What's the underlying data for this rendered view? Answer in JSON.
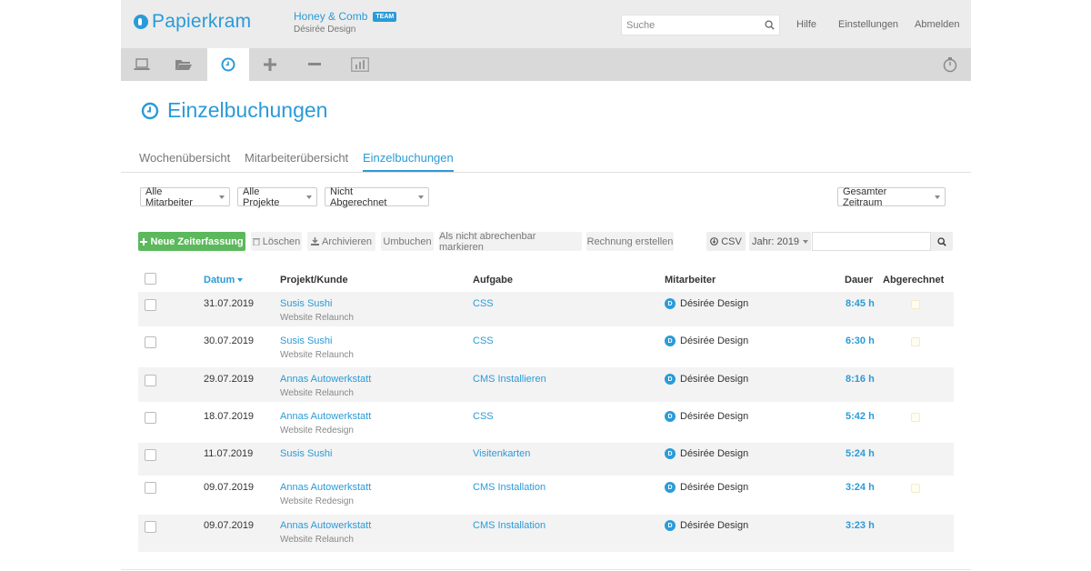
{
  "header": {
    "logo_text": "Papierkram",
    "account_name": "Honey & Comb",
    "account_badge": "TEAM",
    "account_sub": "Désirée Design",
    "search_placeholder": "Suche",
    "links": {
      "help": "Hilfe",
      "settings": "Einstellungen",
      "logout": "Abmelden"
    }
  },
  "nav": {
    "items": [
      {
        "icon": "laptop-icon"
      },
      {
        "icon": "folder-icon"
      },
      {
        "icon": "clock-icon",
        "active": true
      },
      {
        "icon": "plus-icon"
      },
      {
        "icon": "minus-icon"
      },
      {
        "icon": "bar-chart-icon"
      }
    ],
    "right_icon": "stopwatch-icon"
  },
  "page": {
    "title": "Einzelbuchungen"
  },
  "tabs": [
    {
      "label": "Wochenübersicht"
    },
    {
      "label": "Mitarbeiterübersicht"
    },
    {
      "label": "Einzelbuchungen",
      "active": true
    }
  ],
  "filters": {
    "employees": "Alle Mitarbeiter",
    "projects": "Alle Projekte",
    "billing": "Nicht Abgerechnet",
    "period": "Gesamter Zeitraum"
  },
  "toolbar": {
    "new": "Neue Zeiterfassung",
    "delete": "Löschen",
    "archive": "Archivieren",
    "rebook": "Umbuchen",
    "mark_unbillable": "Als nicht abrechenbar markieren",
    "create_invoice": "Rechnung erstellen",
    "csv": "CSV",
    "year": "Jahr: 2019"
  },
  "table": {
    "columns": {
      "date": "Datum",
      "project": "Projekt/Kunde",
      "task": "Aufgabe",
      "employee": "Mitarbeiter",
      "duration": "Dauer",
      "billed": "Abgerechnet"
    },
    "rows": [
      {
        "date": "31.07.2019",
        "project": "Susis Sushi",
        "sub": "Website Relaunch",
        "task": "CSS",
        "avatar": "D",
        "employee": "Désirée Design",
        "duration": "8:45 h"
      },
      {
        "date": "30.07.2019",
        "project": "Susis Sushi",
        "sub": "Website Relaunch",
        "task": "CSS",
        "avatar": "D",
        "employee": "Désirée Design",
        "duration": "6:30 h"
      },
      {
        "date": "29.07.2019",
        "project": "Annas Autowerkstatt",
        "sub": "Website Relaunch",
        "task": "CMS Installieren",
        "avatar": "D",
        "employee": "Désirée Design",
        "duration": "8:16 h"
      },
      {
        "date": "18.07.2019",
        "project": "Annas Autowerkstatt",
        "sub": "Website Redesign",
        "task": "CSS",
        "avatar": "D",
        "employee": "Désirée Design",
        "duration": "5:42 h"
      },
      {
        "date": "11.07.2019",
        "project": "Susis Sushi",
        "sub": "",
        "task": "Visitenkarten",
        "avatar": "D",
        "employee": "Désirée Design",
        "duration": "5:24 h"
      },
      {
        "date": "09.07.2019",
        "project": "Annas Autowerkstatt",
        "sub": "Website Redesign",
        "task": "CMS Installation",
        "avatar": "D",
        "employee": "Désirée Design",
        "duration": "3:24 h"
      },
      {
        "date": "09.07.2019",
        "project": "Annas Autowerkstatt",
        "sub": "Website Relaunch",
        "task": "CMS Installation",
        "avatar": "D",
        "employee": "Désirée Design",
        "duration": "3:23 h"
      }
    ]
  }
}
